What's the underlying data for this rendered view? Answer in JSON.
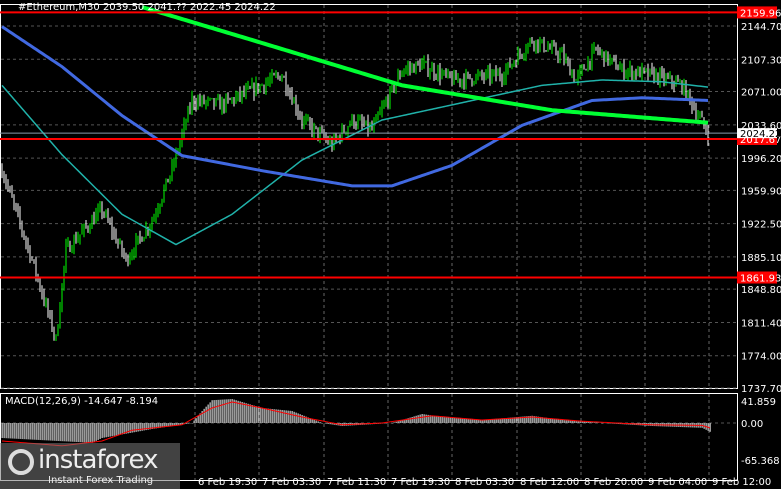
{
  "header": {
    "title": "#Ethereum,M30  2039.50 2041.?? 2022.45 2024.22"
  },
  "macd": {
    "label": "MACD(12,26,9) -14.647 -8.194"
  },
  "watermark": {
    "brand": "instaforex",
    "tagline": "Instant Forex Trading"
  },
  "colors": {
    "bull": "#00ff00",
    "bear": "#ffffff",
    "ma_fast": "#00ff33",
    "ma_mid": "#4169e1",
    "ma_slow": "#20b2aa",
    "level": "#ff0000",
    "hist": "#c0c0c0",
    "signal": "#ff0000"
  },
  "chart_data": [
    {
      "type": "candlestick",
      "title": "#Ethereum,M30",
      "ylim": [
        1737.7,
        2159.96
      ],
      "y_ticks": [
        "2144.70",
        "2107.30",
        "2071.00",
        "2033.60",
        "1996.20",
        "1959.90",
        "1922.50",
        "1885.10",
        "1848.80",
        "1811.40",
        "1774.00",
        "1737.70"
      ],
      "x_ticks": [
        "6 Feb 19:30",
        "7 Feb 03:30",
        "7 Feb 11:30",
        "7 Feb 19:30",
        "8 Feb 03:30",
        "8 Feb 12:00",
        "8 Feb 20:00",
        "9 Feb 04:00",
        "9 Feb 12:00"
      ],
      "levels": [
        {
          "label": "2159.96",
          "value": 2159.96
        },
        {
          "label": "2017.67",
          "value": 2017.67
        },
        {
          "label": "1861.93",
          "value": 1861.93
        }
      ],
      "current": {
        "label": "2024.22",
        "value": 2024.22
      },
      "close_keypoints": [
        [
          0,
          1983
        ],
        [
          5,
          1949
        ],
        [
          15,
          1882
        ],
        [
          27,
          1792
        ],
        [
          32,
          1893
        ],
        [
          50,
          1938
        ],
        [
          62,
          1882
        ],
        [
          75,
          1926
        ],
        [
          85,
          1983
        ],
        [
          95,
          2061
        ],
        [
          110,
          2056
        ],
        [
          120,
          2067
        ],
        [
          140,
          2090
        ],
        [
          150,
          2039
        ],
        [
          165,
          2011
        ],
        [
          175,
          2039
        ],
        [
          185,
          2028
        ],
        [
          200,
          2095
        ],
        [
          210,
          2101
        ],
        [
          225,
          2084
        ],
        [
          250,
          2090
        ],
        [
          265,
          2129
        ],
        [
          280,
          2112
        ],
        [
          287,
          2084
        ],
        [
          297,
          2118
        ],
        [
          310,
          2095
        ],
        [
          325,
          2090
        ],
        [
          340,
          2078
        ],
        [
          353,
          2024
        ]
      ],
      "ma_green": [
        [
          70,
          2166
        ],
        [
          125,
          2129
        ],
        [
          200,
          2078
        ],
        [
          275,
          2050
        ],
        [
          353,
          2036
        ]
      ],
      "ma_blue": [
        [
          0,
          2144
        ],
        [
          30,
          2099
        ],
        [
          60,
          2044
        ],
        [
          90,
          1999
        ],
        [
          130,
          1982
        ],
        [
          175,
          1965
        ],
        [
          195,
          1965
        ],
        [
          225,
          1988
        ],
        [
          260,
          2033
        ],
        [
          295,
          2061
        ],
        [
          320,
          2064
        ],
        [
          353,
          2061
        ]
      ],
      "ma_teal": [
        [
          0,
          2078
        ],
        [
          30,
          2000
        ],
        [
          60,
          1933
        ],
        [
          87,
          1899
        ],
        [
          115,
          1933
        ],
        [
          150,
          1994
        ],
        [
          190,
          2039
        ],
        [
          225,
          2056
        ],
        [
          270,
          2078
        ],
        [
          300,
          2084
        ],
        [
          330,
          2082
        ],
        [
          353,
          2076
        ]
      ]
    },
    {
      "type": "macd",
      "ylim": [
        -65.368,
        41.859
      ],
      "y_ticks": [
        "41.859",
        "0.00",
        "-65.368"
      ],
      "hist_keypoints": [
        [
          0,
          -25
        ],
        [
          45,
          -33
        ],
        [
          50,
          -25
        ],
        [
          75,
          -10
        ],
        [
          95,
          0
        ],
        [
          100,
          20
        ],
        [
          105,
          38
        ],
        [
          115,
          40
        ],
        [
          130,
          25
        ],
        [
          145,
          20
        ],
        [
          160,
          0
        ],
        [
          170,
          -5
        ],
        [
          195,
          0
        ],
        [
          210,
          15
        ],
        [
          220,
          10
        ],
        [
          240,
          5
        ],
        [
          265,
          12
        ],
        [
          280,
          5
        ],
        [
          300,
          0
        ],
        [
          325,
          -5
        ],
        [
          350,
          -8
        ],
        [
          354,
          -14.647
        ]
      ],
      "signal_keypoints": [
        [
          0,
          -30
        ],
        [
          30,
          -38
        ],
        [
          50,
          -30
        ],
        [
          65,
          -12
        ],
        [
          90,
          -3
        ],
        [
          105,
          25
        ],
        [
          115,
          35
        ],
        [
          130,
          25
        ],
        [
          150,
          10
        ],
        [
          170,
          -3
        ],
        [
          190,
          0
        ],
        [
          215,
          12
        ],
        [
          240,
          5
        ],
        [
          265,
          10
        ],
        [
          290,
          3
        ],
        [
          325,
          -3
        ],
        [
          350,
          -4
        ],
        [
          354,
          -8.194
        ]
      ]
    }
  ]
}
